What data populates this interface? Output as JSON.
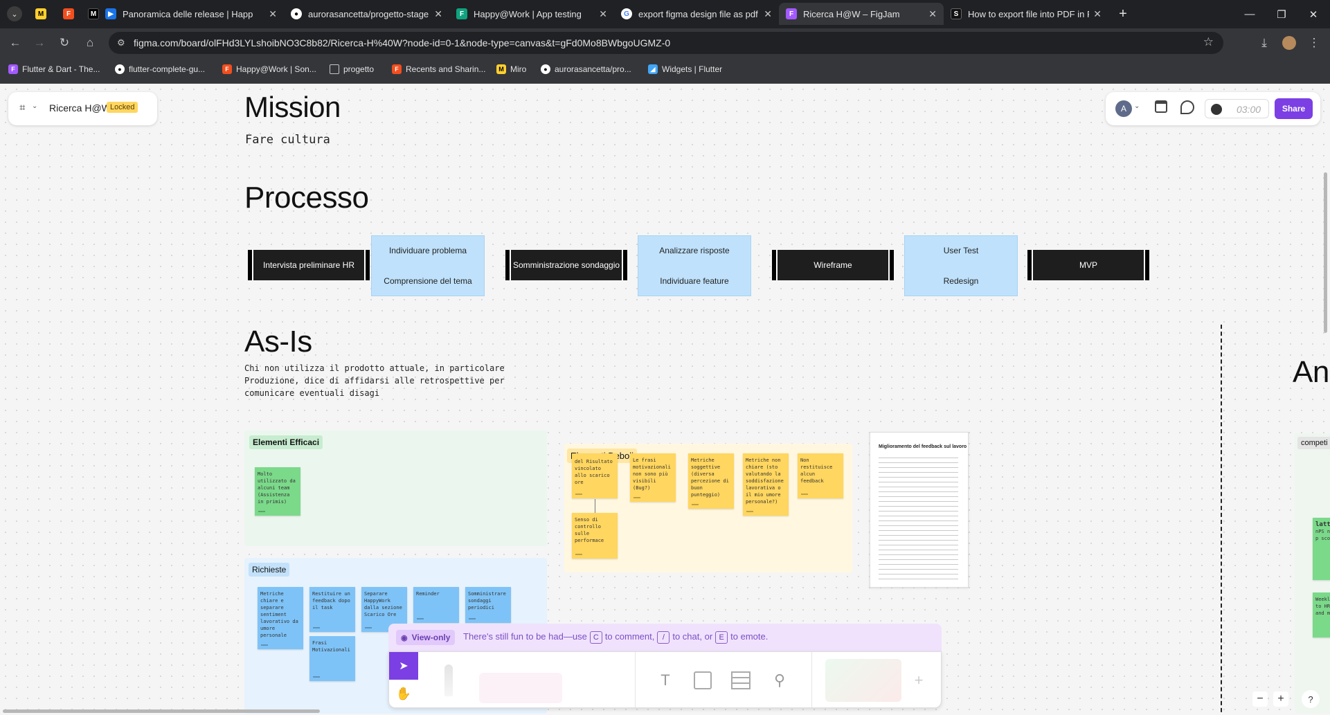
{
  "browser": {
    "tabs": [
      {
        "label": "Panoramica delle release | Happ",
        "favicon": "azure-devops-icon"
      },
      {
        "label": "aurorasancetta/progetto-stage",
        "favicon": "github-icon"
      },
      {
        "label": "Happy@Work | App testing",
        "favicon": "figma-icon"
      },
      {
        "label": "export figma design file as pdf",
        "favicon": "google-icon"
      },
      {
        "label": "Ricerca H@W – FigJam",
        "favicon": "figjam-icon",
        "active": true
      },
      {
        "label": "How to export file into PDF in F",
        "favicon": "s-icon"
      }
    ],
    "pinned_tabs": [
      "miro-icon",
      "figma-icon",
      "medium-icon"
    ],
    "url": "figma.com/board/olFHd3LYLshoibNO3C8b82/Ricerca-H%40W?node-id=0-1&node-type=canvas&t=gFd0Mo8BWbgoUGMZ-0",
    "bookmarks": [
      {
        "label": "Flutter & Dart - The...",
        "icon": "flutter-icon"
      },
      {
        "label": "flutter-complete-gu...",
        "icon": "github-icon"
      },
      {
        "label": "Happy@Work | Son...",
        "icon": "figma-icon"
      },
      {
        "label": "progetto",
        "icon": "folder-icon"
      },
      {
        "label": "Recents and Sharin...",
        "icon": "figma-icon"
      },
      {
        "label": "Miro",
        "icon": "miro-icon"
      },
      {
        "label": "aurorasancetta/pro...",
        "icon": "github-icon"
      },
      {
        "label": "Widgets | Flutter",
        "icon": "flutter-icon"
      }
    ]
  },
  "figjam": {
    "file_name": "Ricerca H@W",
    "locked_badge": "Locked",
    "avatar_initial": "A",
    "timer": "03:00",
    "share_label": "Share",
    "accent": "#7b3fe4"
  },
  "canvas": {
    "mission_title": "Mission",
    "mission_text": "Fare cultura",
    "processo_title": "Processo",
    "process_boxes": [
      "Intervista preliminare HR",
      "Somministrazione sondaggio",
      "Wireframe",
      "MVP"
    ],
    "process_groups": [
      [
        "Individuare problema",
        "Comprensione del tema"
      ],
      [
        "Analizzare risposte",
        "Individuare feature"
      ],
      [
        "User Test",
        "Redesign"
      ]
    ],
    "asis_title": "As-Is",
    "asis_text_lines": [
      "Chi non utilizza il prodotto attuale, in particolare",
      "Produzione, dice di affidarsi alle retrospettive per",
      "comunicare eventuali disagi"
    ],
    "right_title_partial": "An",
    "elementi_efficaci": {
      "label": "Elementi Efficaci",
      "stickies": [
        "Molto utilizzato da alcuni team (Assistenza in primis)"
      ]
    },
    "elementi_deboli": {
      "label": "Elementi Deboli",
      "stickies": [
        "del Risultato vincolato allo scarico ore",
        "Le frasi motivazionali non sono più visibili (Bug?)",
        "Metriche soggettive (diversa percezione di buon punteggio)",
        "Metriche non chiare (sto valutando la soddisfazione lavorativa o il mio umore personale?)",
        "Non restituisce alcun feedback",
        "Senso di controllo sulle performace"
      ]
    },
    "doc_title": "Miglioramento del feedback sul lavoro",
    "richieste": {
      "label": "Richieste",
      "stickies": [
        "Metriche chiare e separare sentiment lavorativo da umore personale",
        "Restituire un feedback dopo il task",
        "Separare HappyWork dalla sezione Scarico Ore",
        "Reminder",
        "Somministrare sondaggi periodici",
        "Frasi Motivazionali"
      ]
    },
    "right_label_partial": "competi",
    "right_sticky_partial": [
      "latti",
      "nPS net p score",
      "Weekl to HR and m"
    ]
  },
  "view_only": {
    "badge": "View-only",
    "text_1": "There's still fun to be had—use",
    "key_1": "C",
    "text_2": "to comment,",
    "key_2": "/",
    "text_3": "to chat, or",
    "key_3": "E",
    "text_4": "to emote."
  }
}
